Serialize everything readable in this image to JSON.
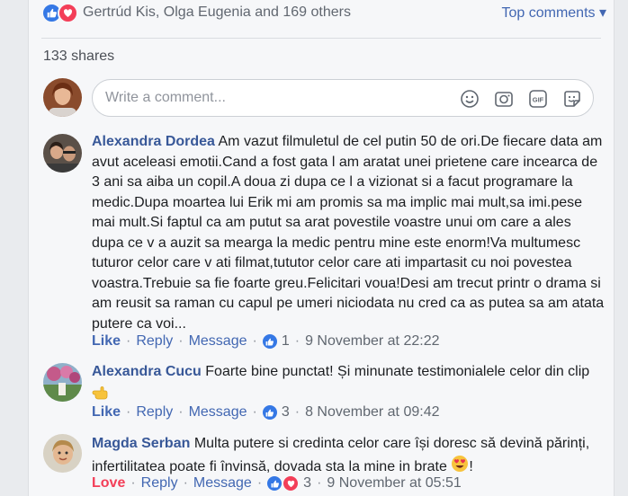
{
  "reactions": {
    "names": "Gertrúd Kis, Olga Eugenia and 169 others",
    "sort_label": "Top comments ▾"
  },
  "shares": "133 shares",
  "comment_box": {
    "placeholder": "Write a comment..."
  },
  "comments": [
    {
      "author": "Alexandra Dordea",
      "text": "Am vazut filmuletul de cel putin 50 de ori.De fiecare data am avut aceleasi emotii.Cand a fost gata l am aratat unei prietene care incearca de 3 ani sa aiba un copil.A doua zi dupa ce l a vizionat si a facut programare la medic.Dupa moartea lui Erik mi am promis sa ma implic mai mult,sa imi.pese mai mult.Si faptul ca am putut sa arat povestile voastre unui om care a ales dupa ce v a auzit sa mearga la medic pentru mine este enorm!Va multumesc tuturor celor care v ati filmat,tututor celor care ati impartasit cu noi povestea voastra.Trebuie sa fie foarte greu.Felicitari voua!Desi am trecut printr o drama si am reusit sa raman cu capul pe umeri niciodata nu cred ca as putea sa am atata putere ca voi...",
      "like": "Like",
      "reply": "Reply",
      "message": "Message",
      "count": "1",
      "time": "9 November at 22:22"
    },
    {
      "author": "Alexandra Cucu",
      "text": "Foarte bine punctat! Și minunate testimonialele celor din clip",
      "like": "Like",
      "reply": "Reply",
      "message": "Message",
      "count": "3",
      "time": "8 November at 09:42"
    },
    {
      "author": "Magda Serban",
      "text": "Multa putere si credinta celor care își doresc să devină părinți, infertilitatea poate fi învinsă, dovada sta la mine in brate",
      "text_end": "!",
      "like": "Love",
      "reply": "Reply",
      "message": "Message",
      "count": "3",
      "time": "9 November at 05:51"
    }
  ]
}
